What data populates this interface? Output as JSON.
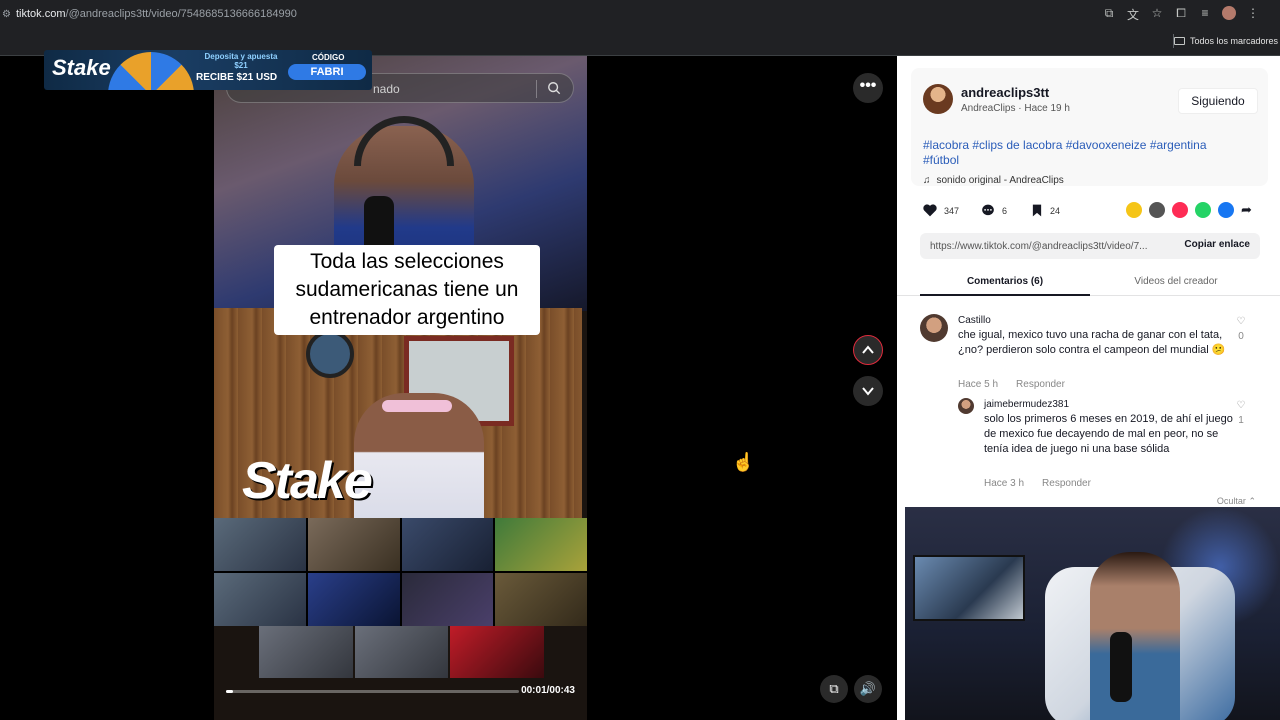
{
  "browser": {
    "url_host": "tiktok.com",
    "url_path": "/@andreaclips3tt/video/7548685136666184990",
    "bookmarks_label": "Todos los marcadores"
  },
  "ad": {
    "brand": "Stake",
    "deposit_text": "Deposita y apuesta $21",
    "bonus_text": "RECIBE $21 USD",
    "code_label": "CÓDIGO",
    "code": "FABRI"
  },
  "search": {
    "visible_text": "nado"
  },
  "video": {
    "caption": "Toda las selecciones sudamericanas tiene un entrenador argentino",
    "overlay_logo": "Stake",
    "progress": 0.023,
    "time": "00:01/00:43"
  },
  "creator": {
    "username": "andreaclips3tt",
    "meta": "AndreaClips · Hace 19 h",
    "follow_label": "Siguiendo",
    "description": "#lacobra #clips de lacobra #davooxeneize #argentina #fútbol",
    "sound": "sonido original - AndreaClips"
  },
  "stats": {
    "likes": "347",
    "comments": "6",
    "saves": "24"
  },
  "link": {
    "url": "https://www.tiktok.com/@andreaclips3tt/video/7...",
    "copy_label": "Copiar enlace"
  },
  "tabs": {
    "comments": "Comentarios (6)",
    "creator_videos": "Videos del creador"
  },
  "comments": [
    {
      "user": "Castillo",
      "text": "che igual, mexico tuvo una racha de ganar con el tata, ¿no? perdieron solo contra el campeon del mundial 😕",
      "time": "Hace 5 h",
      "reply_label": "Responder",
      "likes": "0"
    },
    {
      "user": "jaimebermudez381",
      "text": "solo los primeros 6 meses en 2019, de ahí el juego de mexico fue decayendo de mal en peor, no se tenía idea de juego ni una base sólida",
      "time": "Hace 3 h",
      "reply_label": "Responder",
      "likes": "1"
    }
  ],
  "hide_label": "Ocultar",
  "colors": {
    "tiktok_red": "#e02b3c",
    "hashtag_blue": "#2b5db9"
  }
}
